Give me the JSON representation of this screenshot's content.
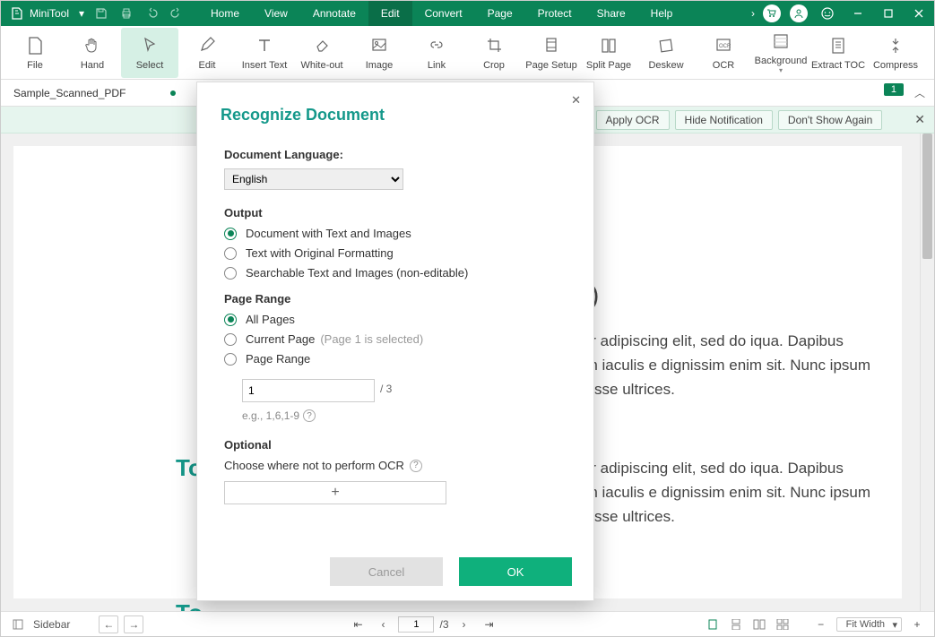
{
  "app": {
    "name": "MiniTool"
  },
  "menus": [
    "Home",
    "View",
    "Annotate",
    "Edit",
    "Convert",
    "Page",
    "Protect",
    "Share",
    "Help"
  ],
  "ribbon": [
    {
      "label": "File"
    },
    {
      "label": "Hand"
    },
    {
      "label": "Select"
    },
    {
      "label": "Edit"
    },
    {
      "label": "Insert Text"
    },
    {
      "label": "White-out"
    },
    {
      "label": "Image"
    },
    {
      "label": "Link"
    },
    {
      "label": "Crop"
    },
    {
      "label": "Page Setup"
    },
    {
      "label": "Split Page"
    },
    {
      "label": "Deskew"
    },
    {
      "label": "OCR"
    },
    {
      "label": "Background"
    },
    {
      "label": "Extract TOC"
    },
    {
      "label": "Compress"
    }
  ],
  "tab": {
    "name": "Sample_Scanned_PDF",
    "badge": "1"
  },
  "notif": {
    "apply": "Apply OCR",
    "hide": "Hide Notification",
    "dont": "Don't Show Again"
  },
  "doc": {
    "h1": "yle 1)",
    "h2a": "To",
    "h2b": "To",
    "para1": "nsectetur adipiscing elit, sed do iqua. Dapibus ultrices in iaculis e dignissim enim sit. Nunc ipsum suspendisse ultrices.",
    "para2": "nsectetur adipiscing elit, sed do iqua. Dapibus ultrices in iaculis e dignissim enim sit. Nunc ipsum suspendisse ultrices."
  },
  "status": {
    "sidebar": "Sidebar",
    "page_current": "1",
    "page_total": "/3",
    "zoom": "Fit Width"
  },
  "dialog": {
    "title": "Recognize Document",
    "lang_label": "Document Language:",
    "lang_value": "English",
    "output_label": "Output",
    "out1": "Document with Text and Images",
    "out2": "Text with Original Formatting",
    "out3": "Searchable Text and Images (non-editable)",
    "range_label": "Page Range",
    "r1": "All Pages",
    "r2": "Current Page",
    "r2_hint": "(Page 1 is selected)",
    "r3": "Page Range",
    "range_value": "1",
    "range_suffix": "/ 3",
    "range_eg": "e.g., 1,6,1-9",
    "optional_label": "Optional",
    "optional_text": "Choose where not to perform OCR",
    "add": "+",
    "cancel": "Cancel",
    "ok": "OK"
  }
}
